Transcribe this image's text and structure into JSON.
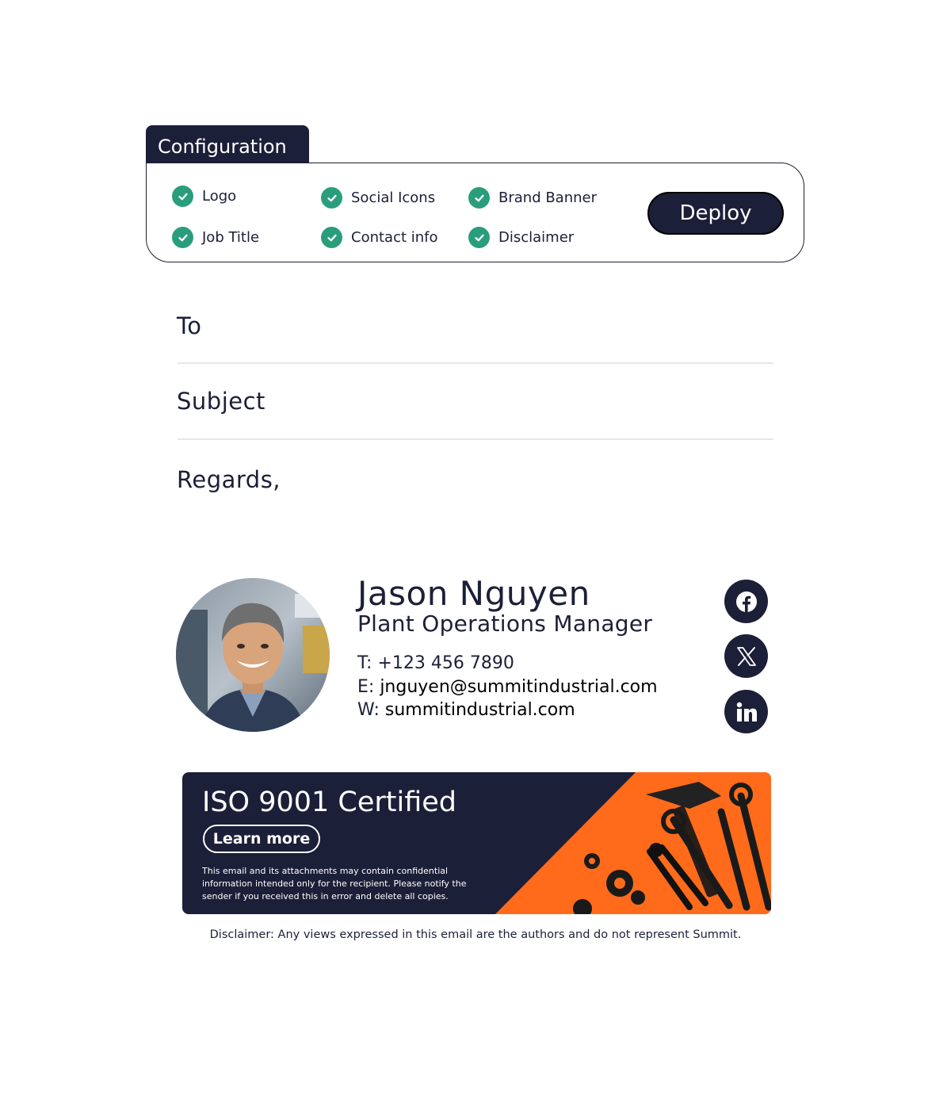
{
  "config": {
    "tab_title": "Configuration",
    "options": [
      {
        "label": "Logo",
        "checked": true
      },
      {
        "label": "Social Icons",
        "checked": true
      },
      {
        "label": "Brand Banner",
        "checked": true
      },
      {
        "label": "Job Title",
        "checked": true
      },
      {
        "label": "Contact info",
        "checked": true
      },
      {
        "label": "Disclaimer",
        "checked": true
      }
    ],
    "deploy_label": "Deploy"
  },
  "email": {
    "to_label": "To",
    "subject_label": "Subject",
    "body_text": "Regards,"
  },
  "signature": {
    "name": "Jason Nguyen",
    "title": "Plant Operations Manager",
    "phone_prefix": "T: ",
    "phone": "+123 456 7890",
    "email_prefix": "E: ",
    "email": "jnguyen@summitindustrial.com",
    "web_prefix": "W: ",
    "web": "summitindustrial.com",
    "social_icons": [
      "facebook-icon",
      "x-twitter-icon",
      "linkedin-icon"
    ]
  },
  "banner": {
    "title": "ISO 9001 Certified",
    "button_label": "Learn more",
    "text": "This email and its attachments may contain confidential information intended only for the recipient. Please notify the sender if you received this in error and delete all copies."
  },
  "disclaimer": "Disclaimer: Any views expressed in this email are the authors and do not represent Summit.",
  "colors": {
    "navy": "#1c1f38",
    "check_green": "#2a9d7c",
    "banner_orange": "#ff6b1a"
  }
}
